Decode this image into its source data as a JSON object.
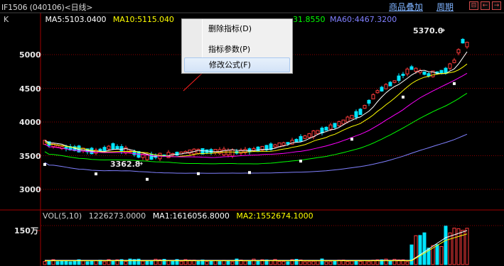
{
  "window": {
    "title": "IF1506 (040106)<日线>",
    "links": [
      "商品叠加",
      "周期"
    ],
    "buttons": [
      "⊟",
      "←",
      "→"
    ]
  },
  "indicators": {
    "k_label": "K",
    "ma5": "MA5:5103.0400",
    "ma10": "MA10:5115.040",
    "ma20_tail": "31.8550",
    "ma60": "MA60:4467.3200"
  },
  "volume": {
    "label": "VOL(5,10)",
    "vol": "1226273.0000",
    "ma1": "MA1:1616056.8000",
    "ma2": "MA2:1552674.1000",
    "axis_label": "150万"
  },
  "price_axis": [
    "5000",
    "4500",
    "4000",
    "3500",
    "3000"
  ],
  "annotations": {
    "high": "5370.0",
    "low": "3362.8"
  },
  "context_menu": {
    "items": [
      "删除指标(D)",
      "指标参数(P)",
      "修改公式(F)"
    ],
    "highlighted_index": 2
  },
  "colors": {
    "up": "#ff3b3b",
    "down": "#00e5ff",
    "ma5": "#ffffff",
    "ma10": "#ffff00",
    "ma20": "#ff00ff",
    "ma30": "#00ff00",
    "ma60": "#8080ff",
    "grid": "#8b0000",
    "link": "#7fb3ff"
  },
  "chart_data": {
    "type": "candlestick",
    "y_axis_ticks": [
      3000,
      3500,
      4000,
      4500,
      5000
    ],
    "marked_high": 5370.0,
    "marked_low": 3362.8,
    "series": [
      {
        "name": "MA5",
        "last": 5103.04
      },
      {
        "name": "MA10",
        "last": 5115.04
      },
      {
        "name": "MA60",
        "last": 4467.32
      }
    ],
    "volume_series": [
      {
        "name": "VOL",
        "last": 1226273.0
      },
      {
        "name": "MA1",
        "last": 1616056.8
      },
      {
        "name": "MA2",
        "last": 1552674.1
      }
    ]
  }
}
